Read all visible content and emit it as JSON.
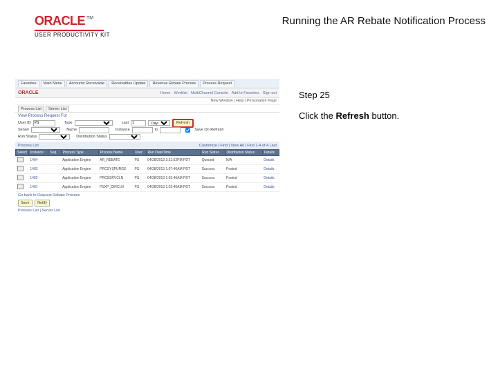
{
  "header": {
    "brand": "ORACLE",
    "tm": "TM",
    "product": "USER PRODUCTIVITY KIT",
    "title": "Running the AR Rebate Notification Process"
  },
  "sidebar": {
    "step": "Step 25",
    "instr_pre": "Click the ",
    "instr_bold": "Refresh",
    "instr_post": " button."
  },
  "shot": {
    "top_tabs": [
      "Favorites",
      "Main Menu",
      "Accounts Receivable",
      "Receivables Update",
      "Revenue Rebate Process",
      "Process Request"
    ],
    "oracle": "ORACLE",
    "top_links": [
      "Home",
      "Worklist",
      "MultiChannel Console",
      "Add to Favorites",
      "Sign out"
    ],
    "context": "New Window | Help | Personalize Page",
    "subtabs": [
      "Process List",
      "Server List"
    ],
    "section": "View Process Request For",
    "form": {
      "user_lbl": "User ID",
      "user_val": "PS",
      "type_lbl": "Type",
      "type_val": "",
      "last_lbl": "Last",
      "last_val": "1",
      "last_unit": "Days",
      "refresh": "Refresh",
      "server_lbl": "Server",
      "server_val": "",
      "name_lbl": "Name",
      "name_val": "",
      "instance_lbl": "Instance",
      "instance_val": "",
      "to_lbl": "to",
      "to_val": "",
      "save_chk": "Save On Refresh"
    },
    "run_lbl": "Run Status",
    "run_val": "",
    "dist_lbl": "Distribution Status",
    "dist_val": "",
    "list_title": "Process List",
    "pager": "Customize | Find | View All | First 1-4 of 4 Last",
    "cols": [
      "Select",
      "Instance",
      "Seq.",
      "Process Type",
      "Process Name",
      "User",
      "Run Date/Time",
      "Run Status",
      "Distribution Status",
      "Details"
    ],
    "rows": [
      {
        "inst": "1484",
        "seq": "",
        "ptype": "Application Engine",
        "pname": "AR_REBATE",
        "user": "PS",
        "dt": "04/28/2013 3:21:52PM PDT",
        "rs": "Queued",
        "ds": "N/A",
        "det": "Details"
      },
      {
        "inst": "1483",
        "seq": "",
        "ptype": "Application Engine",
        "pname": "PRCSYSPURGE",
        "user": "PS",
        "dt": "04/28/2013 1:07:46AM PDT",
        "rs": "Success",
        "ds": "Posted",
        "det": "Details"
      },
      {
        "inst": "1482",
        "seq": "",
        "ptype": "Application Engine",
        "pname": "PRCSSRVCLN",
        "user": "PS",
        "dt": "04/28/2013 1:02:46AM PDT",
        "rs": "Success",
        "ds": "Posted",
        "det": "Details"
      },
      {
        "inst": "1481",
        "seq": "",
        "ptype": "Application Engine",
        "pname": "PSXP_DIRCLN",
        "user": "PS",
        "dt": "04/28/2013 1:02:46AM PDT",
        "rs": "Success",
        "ds": "Posted",
        "det": "Details"
      }
    ],
    "goback": "Go back to Request Rebate Process",
    "save_btn": "Save",
    "notify_btn": "Notify",
    "foot_tabs": "Process List | Server List"
  }
}
